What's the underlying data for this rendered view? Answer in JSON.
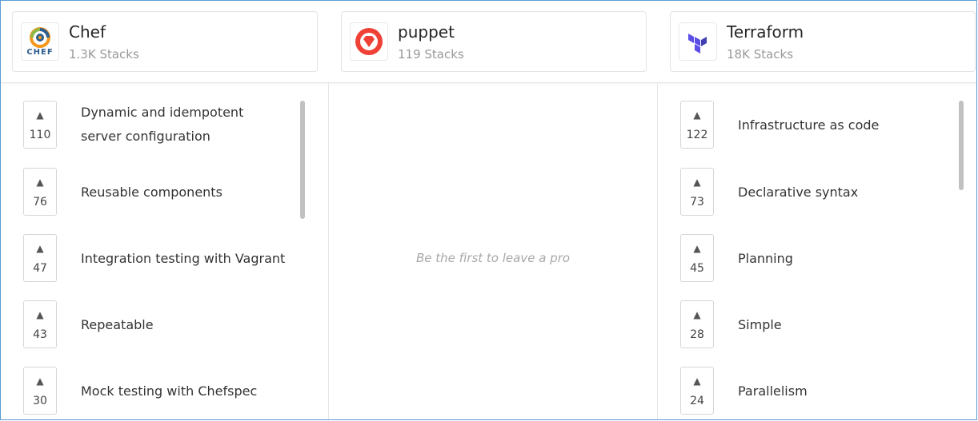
{
  "tools": [
    {
      "name": "Chef",
      "stacks": "1.3K Stacks",
      "logo_text": "CHEF"
    },
    {
      "name": "puppet",
      "stacks": "119 Stacks"
    },
    {
      "name": "Terraform",
      "stacks": "18K Stacks"
    }
  ],
  "pros": {
    "chef": [
      {
        "votes": "110",
        "text_lines": [
          "Dynamic and idempotent",
          "server configuration"
        ]
      },
      {
        "votes": "76",
        "text": "Reusable components"
      },
      {
        "votes": "47",
        "text": "Integration testing with Vagrant"
      },
      {
        "votes": "43",
        "text": "Repeatable"
      },
      {
        "votes": "30",
        "text": "Mock testing with Chefspec"
      }
    ],
    "puppet_empty": "Be the first to leave a pro",
    "terraform": [
      {
        "votes": "122",
        "text": "Infrastructure as code"
      },
      {
        "votes": "73",
        "text": "Declarative syntax"
      },
      {
        "votes": "45",
        "text": "Planning"
      },
      {
        "votes": "28",
        "text": "Simple"
      },
      {
        "votes": "24",
        "text": "Parallelism"
      }
    ]
  },
  "upvote_glyph": "▲",
  "colors": {
    "chef_orange": "#F09820",
    "chef_blue": "#2E5E8E",
    "puppet_red": "#EF4136",
    "terraform_purple": "#5C4EE5",
    "frame_blue": "#5A9BD5"
  },
  "icons": [
    "chef-logo-icon",
    "puppet-logo-icon",
    "terraform-logo-icon",
    "upvote-arrow-icon"
  ]
}
